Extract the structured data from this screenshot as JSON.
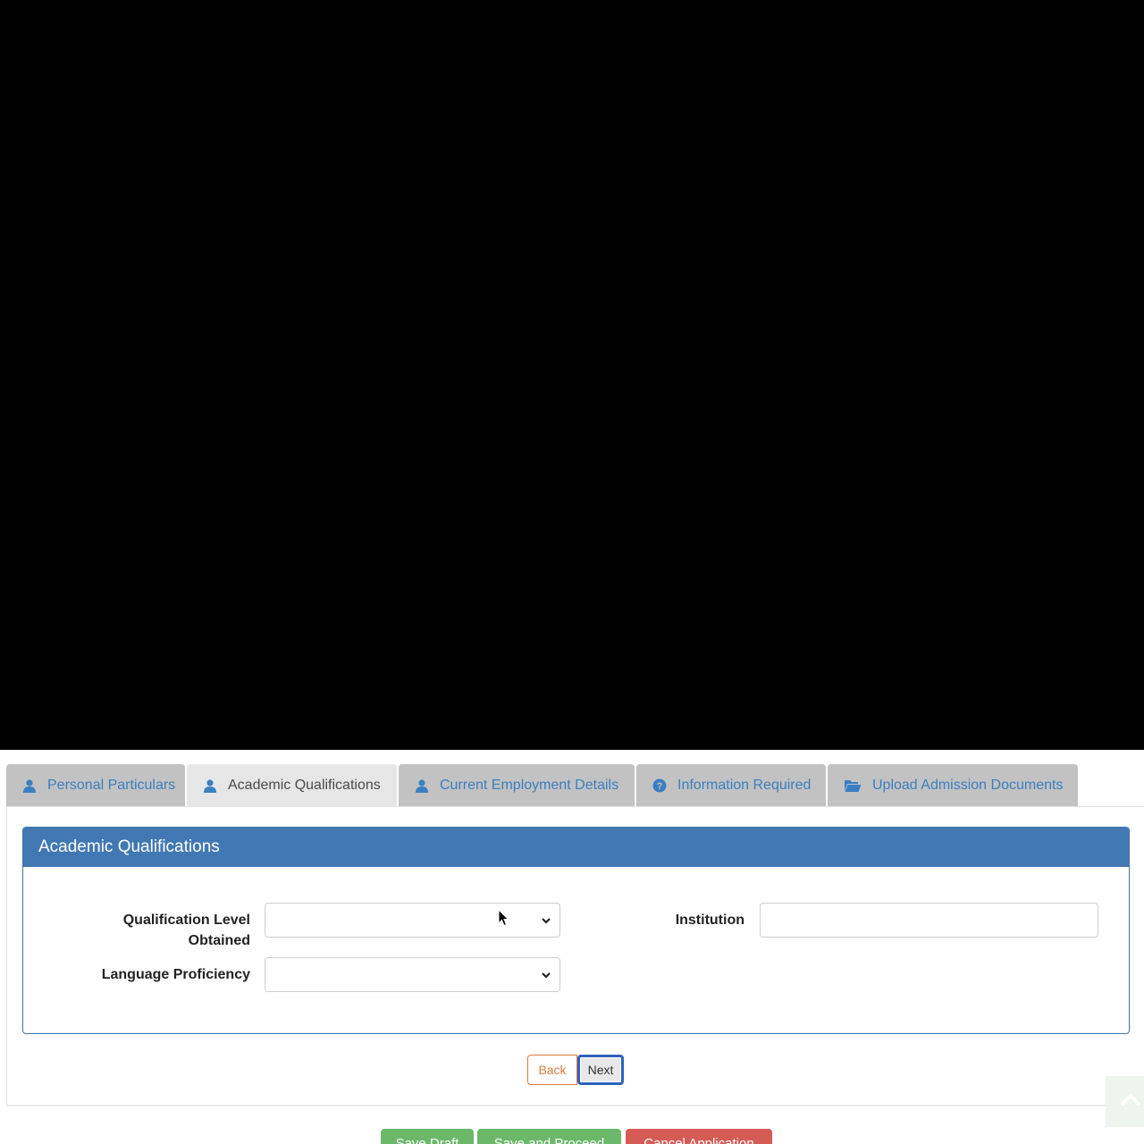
{
  "tabs": [
    {
      "label": "Personal Particulars",
      "icon": "user-icon",
      "active": false
    },
    {
      "label": "Academic Qualifications",
      "icon": "user-icon",
      "active": true
    },
    {
      "label": "Current Employment Details",
      "icon": "user-icon",
      "active": false
    },
    {
      "label": "Information Required",
      "icon": "question-circle-icon",
      "active": false
    },
    {
      "label": "Upload Admission Documents",
      "icon": "folder-open-icon",
      "active": false
    }
  ],
  "panel": {
    "title": "Academic Qualifications",
    "fields": {
      "qualification_level_label": "Qualification Level Obtained",
      "qualification_level_value": "",
      "institution_label": "Institution",
      "institution_value": "",
      "language_proficiency_label": "Language Proficiency",
      "language_proficiency_value": ""
    }
  },
  "navigation": {
    "back_label": "Back",
    "next_label": "Next"
  },
  "footer_actions": {
    "save_draft_label": "Save Draft",
    "save_proceed_label": "Save and Proceed",
    "cancel_label": "Cancel Application"
  },
  "colors": {
    "accent": "#4178b3",
    "tab_link": "#3a7fc1",
    "back_button": "#e07a3e",
    "save_button": "#6bb86a",
    "cancel_button": "#d55c56"
  }
}
